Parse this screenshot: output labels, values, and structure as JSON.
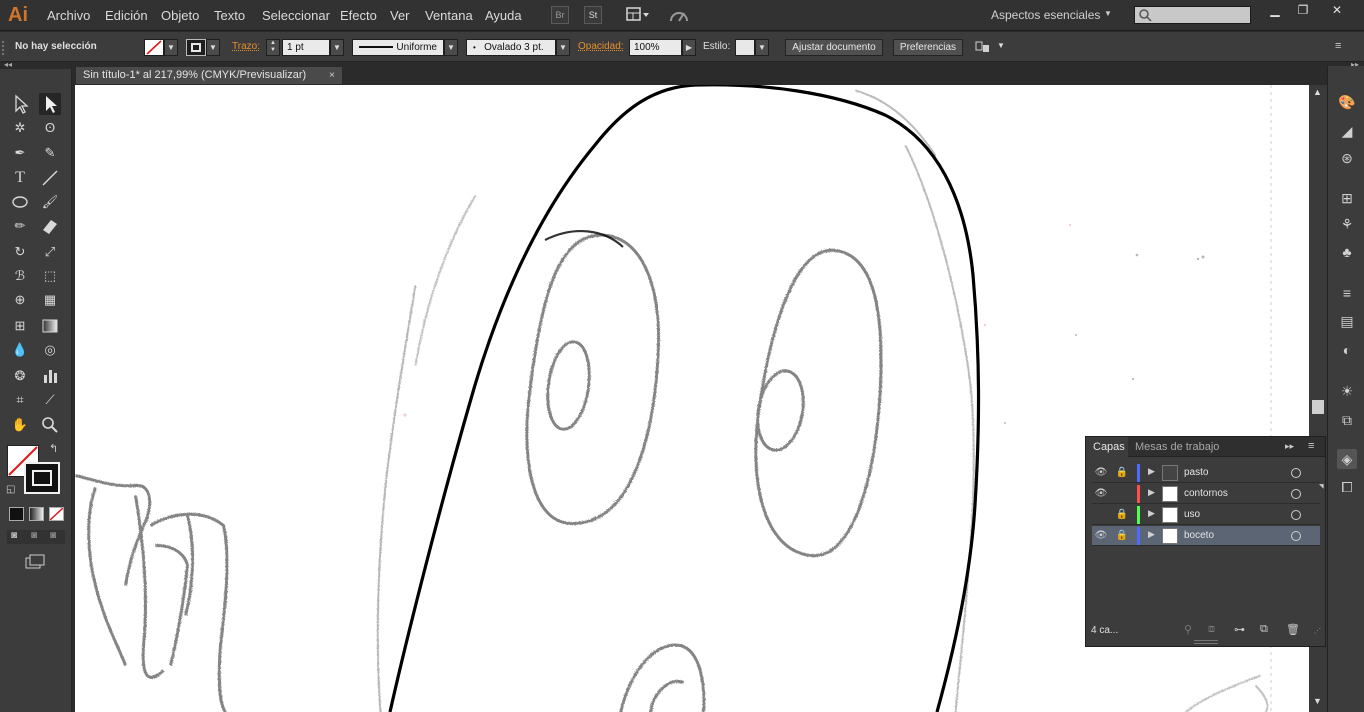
{
  "app": {
    "logo": "Ai",
    "menu": [
      "Archivo",
      "Edición",
      "Objeto",
      "Texto",
      "Seleccionar",
      "Efecto",
      "Ver",
      "Ventana",
      "Ayuda"
    ],
    "bridge_button": "Br",
    "stock_button": "St",
    "workspace": "Aspectos esenciales",
    "search_placeholder": ""
  },
  "control_bar": {
    "selection_status": "No hay selección",
    "stroke_label": "Trazo:",
    "stroke_weight": "1 pt",
    "profile": "Uniforme",
    "brush": "Ovalado 3 pt.",
    "opacity_label": "Opacidad:",
    "opacity_value": "100%",
    "style_label": "Estilo:",
    "fit_document_button": "Ajustar documento",
    "preferences_button": "Preferencias"
  },
  "document": {
    "tab_title": "Sin título-1* al 217,99% (CMYK/Previsualizar)",
    "close_glyph": "×"
  },
  "layers_panel": {
    "tabs": [
      "Capas",
      "Mesas de trabajo"
    ],
    "active_tab": "Capas",
    "layers": [
      {
        "name": "pasto",
        "visible": true,
        "locked": true,
        "color": "#4f6bff",
        "selected": false
      },
      {
        "name": "contornos",
        "visible": true,
        "locked": false,
        "color": "#ff4f4f",
        "selected": false
      },
      {
        "name": "uso",
        "visible": false,
        "locked": true,
        "color": "#4fff4f",
        "selected": false
      },
      {
        "name": "boceto",
        "visible": true,
        "locked": true,
        "color": "#4f6bff",
        "selected": true
      }
    ],
    "footer_count": "4 ca..."
  },
  "colors": {
    "accent_orange": "#e6902c",
    "selected_row": "#5b6573"
  }
}
